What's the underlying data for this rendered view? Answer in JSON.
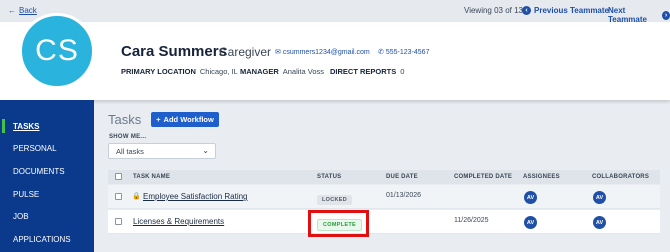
{
  "topbar": {
    "back_label": "Back",
    "viewing": "Viewing 03 of 13",
    "prev_label": "Previous Teammate",
    "next_label": "Next Teammate"
  },
  "profile": {
    "initials": "CS",
    "name": "Cara Summers",
    "role": "Caregiver",
    "email": "csummers1234@gmail.com",
    "phone": "555-123-4567",
    "primary_location_label": "PRIMARY LOCATION",
    "primary_location": "Chicago, IL",
    "manager_label": "MANAGER",
    "manager": "Analita Voss",
    "direct_reports_label": "DIRECT REPORTS",
    "direct_reports": "0",
    "avatar_color": "#29b3dd"
  },
  "sidebar": {
    "items": [
      {
        "label": "TASKS",
        "active": true
      },
      {
        "label": "PERSONAL",
        "active": false
      },
      {
        "label": "DOCUMENTS",
        "active": false
      },
      {
        "label": "PULSE",
        "active": false
      },
      {
        "label": "JOB",
        "active": false
      },
      {
        "label": "APPLICATIONS",
        "active": false
      }
    ],
    "accent": "#42c24a",
    "background": "#0b3a8c"
  },
  "tasks": {
    "title": "Tasks",
    "add_workflow_label": "Add Workflow",
    "show_me_label": "SHOW ME...",
    "filter_value": "All tasks",
    "columns": [
      "TASK NAME",
      "STATUS",
      "DUE DATE",
      "COMPLETED DATE",
      "ASSIGNEES",
      "COLLABORATORS"
    ],
    "rows": [
      {
        "name": "Employee Satisfaction Rating",
        "locked_icon": "lock-icon",
        "status": "LOCKED",
        "due_date": "01/13/2026",
        "completed_date": "",
        "assignee": "AV",
        "collaborator": "AV"
      },
      {
        "name": "Licenses & Requirements",
        "status": "COMPLETE",
        "due_date": "",
        "completed_date": "11/26/2025",
        "assignee": "AV",
        "collaborator": "AV"
      }
    ],
    "highlight_color": "#e01010"
  }
}
